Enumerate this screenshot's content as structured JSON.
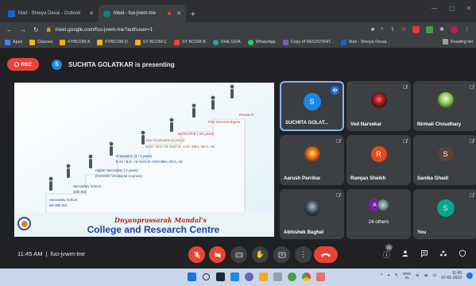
{
  "browser": {
    "tabs": [
      {
        "label": "Mail - Shreya Desai - Outlook",
        "active": false
      },
      {
        "label": "Meet - fuo-jvwm-tne",
        "active": true
      }
    ],
    "new_tab_icon": "+",
    "url": "meet.google.com/fuo-jvwm-tne?authuser=1",
    "bookmarks": [
      "Apps",
      "Classes",
      "FYBCOM A",
      "FYBCOM D",
      "SY BCOM C",
      "SY BCOM B",
      "DHE GOA",
      "WhatsApp",
      "Copy of REGISTRAT...",
      "Mail - Shreya Desai..."
    ],
    "reading_list": "Reading list"
  },
  "meet": {
    "rec_label": "REC",
    "presenter_initial": "S",
    "presenting_text": "SUCHITA GOLATKAR is presenting",
    "meeting_time": "11:45 AM",
    "meeting_separator": "|",
    "meeting_code": "fuo-jvwm-tne",
    "participant_badge": "33"
  },
  "slide": {
    "steps": [
      "Research",
      "Post Doctoral degree",
      "M.Phil./PhD ( 2/3 years)",
      "Post Graduation (2 years)",
      "M.Sc / M.S / M.Tech/ M. Arch, MBA, MCA, etc.",
      "Graduation  (3 / 4 years)",
      "B.Sc / B.E. / B.Tech/ B. Arch/ BBA, BCA,  etc",
      "Higher Secondary ( 2 years)",
      "(General / Vocational Courses)",
      "Secondary School",
      "10th  Std",
      "Secondary School",
      "8th /9th  Std"
    ],
    "institution_script": "Dnyanprassarak Mandal's",
    "institution_name": "College and Research Centre"
  },
  "participants": [
    {
      "name": "SUCHITA GOLAT...",
      "initial": "S",
      "color": "#1e88e5",
      "speaking": true
    },
    {
      "name": "Ved Narvekar",
      "photo": true
    },
    {
      "name": "Nirmali Choudhary",
      "photo": true
    },
    {
      "name": "Aarush Parrikar",
      "photo": true
    },
    {
      "name": "Ramjan Sheikh",
      "initial": "R",
      "color": "#e64a19"
    },
    {
      "name": "Sanika Ghadi",
      "initial": "S",
      "color": "#5d4037"
    },
    {
      "name": "Abhishek Baghel",
      "photo": true
    },
    {
      "name": "24 others",
      "initial": "A"
    },
    {
      "name": "You",
      "initial": "S",
      "color": "#00a884"
    }
  ],
  "taskbar": {
    "lang_top": "ENG",
    "lang_bottom": "IN",
    "time": "11:45",
    "date": "07-01-2022"
  },
  "colors": {
    "accent": "#1a73e8",
    "danger": "#ea4335",
    "speaking_border": "#8ab4f8"
  }
}
